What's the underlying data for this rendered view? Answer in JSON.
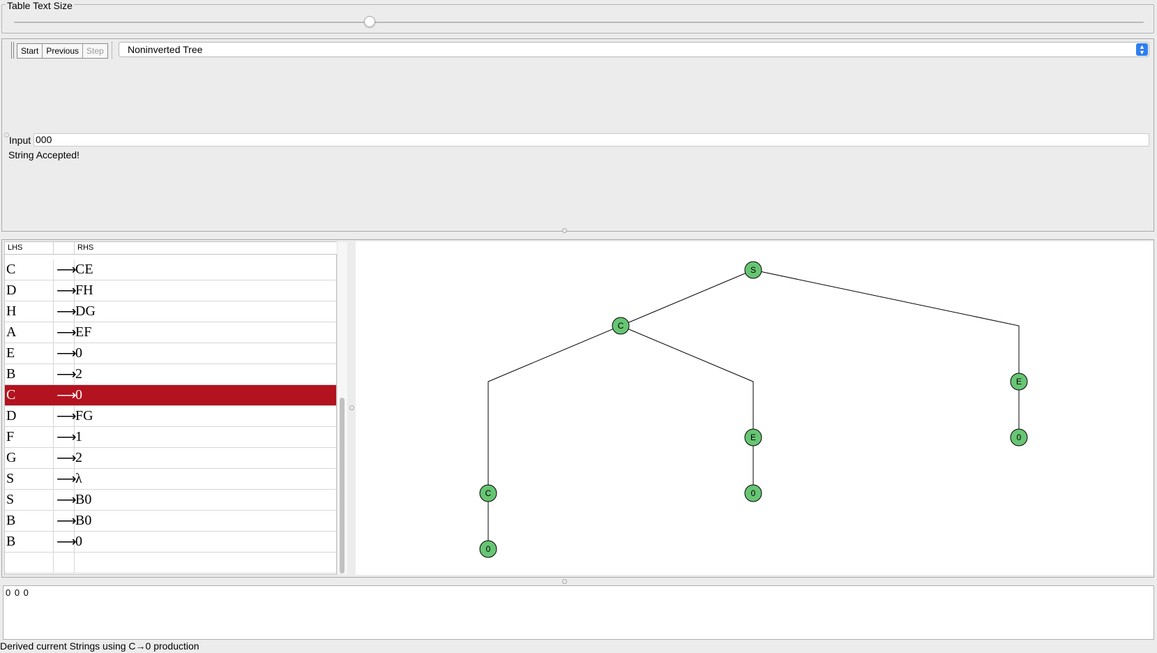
{
  "slider": {
    "legend": "Table Text Size",
    "value_fraction": 0.315
  },
  "toolbar": {
    "start_label": "Start",
    "previous_label": "Previous",
    "step_label": "Step"
  },
  "view_select": {
    "selected": "Noninverted Tree"
  },
  "input": {
    "label": "Input",
    "value": "000"
  },
  "status": {
    "message": "String Accepted!"
  },
  "table": {
    "headers": {
      "lhs": "LHS",
      "arrow": "",
      "rhs": "RHS"
    },
    "arrow_symbol": "⟶",
    "rows": [
      {
        "lhs": "C",
        "rhs": "CE"
      },
      {
        "lhs": "D",
        "rhs": "FH"
      },
      {
        "lhs": "H",
        "rhs": "DG"
      },
      {
        "lhs": "A",
        "rhs": "EF"
      },
      {
        "lhs": "E",
        "rhs": "0"
      },
      {
        "lhs": "B",
        "rhs": "2"
      },
      {
        "lhs": "C",
        "rhs": "0",
        "selected": true
      },
      {
        "lhs": "D",
        "rhs": "FG"
      },
      {
        "lhs": "F",
        "rhs": "1"
      },
      {
        "lhs": "G",
        "rhs": "2"
      },
      {
        "lhs": "S",
        "rhs": "λ"
      },
      {
        "lhs": "S",
        "rhs": "B0"
      },
      {
        "lhs": "B",
        "rhs": "B0"
      },
      {
        "lhs": "B",
        "rhs": "0"
      },
      {
        "lhs": "",
        "rhs": ""
      }
    ]
  },
  "tree": {
    "node_color": "#67c574",
    "nodes": [
      {
        "id": "n1",
        "label": "S"
      },
      {
        "id": "n2",
        "label": "C"
      },
      {
        "id": "n3",
        "label": "E"
      },
      {
        "id": "n4",
        "label": "E"
      },
      {
        "id": "n5",
        "label": "0"
      },
      {
        "id": "n6",
        "label": "0"
      },
      {
        "id": "n7",
        "label": "C"
      },
      {
        "id": "n8",
        "label": "0"
      }
    ]
  },
  "derived": {
    "text": "0 0 0"
  },
  "footer": {
    "message": "Derived current Strings using C→0 production"
  },
  "colors": {
    "selected_row": "#b3121f",
    "select_arrow": "#2f7ff0"
  }
}
